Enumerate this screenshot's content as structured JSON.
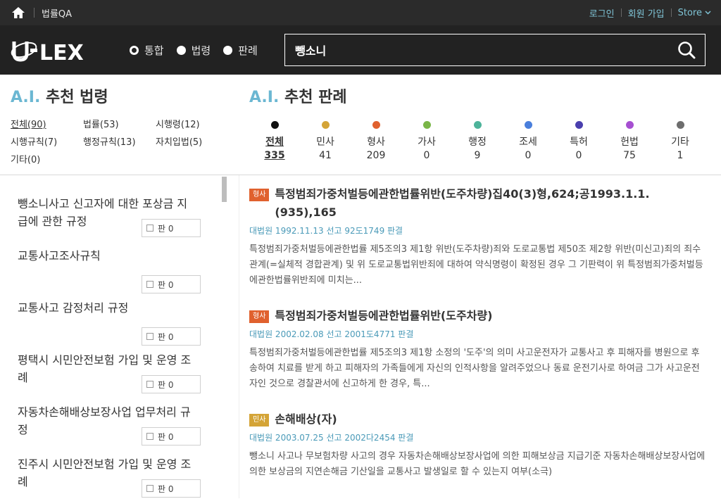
{
  "topbar": {
    "home_icon": "home-icon",
    "breadcrumb": "법률QA",
    "login": "로그인",
    "signup": "회원 가입",
    "store": "Store"
  },
  "header": {
    "logo": "U-LEX",
    "scopes": [
      {
        "label": "통합",
        "selected": true
      },
      {
        "label": "법령",
        "selected": false
      },
      {
        "label": "판례",
        "selected": false
      }
    ],
    "search": {
      "value": "뺑소니",
      "icon": "search-icon"
    }
  },
  "law_filter": {
    "heading_prefix": "A.I.",
    "heading": "추천 법령",
    "links": [
      {
        "label": "전체(90)",
        "active": true
      },
      {
        "label": "법률(53)",
        "active": false
      },
      {
        "label": "시행령(12)",
        "active": false
      },
      {
        "label": "시행규칙(7)",
        "active": false
      },
      {
        "label": "행정규칙(13)",
        "active": false
      },
      {
        "label": "자치입법(5)",
        "active": false
      },
      {
        "label": "기타(0)",
        "active": false
      }
    ]
  },
  "case_filter": {
    "heading_prefix": "A.I.",
    "heading": "추천 판례",
    "categories": [
      {
        "label": "전체",
        "count": "335",
        "color": "#111111",
        "active": true
      },
      {
        "label": "민사",
        "count": "41",
        "color": "#d4a437",
        "active": false
      },
      {
        "label": "형사",
        "count": "209",
        "color": "#e0612e",
        "active": false
      },
      {
        "label": "가사",
        "count": "0",
        "color": "#7ab648",
        "active": false
      },
      {
        "label": "행정",
        "count": "9",
        "color": "#4db39a",
        "active": false
      },
      {
        "label": "조세",
        "count": "0",
        "color": "#4a7fdc",
        "active": false
      },
      {
        "label": "특허",
        "count": "0",
        "color": "#4a3fae",
        "active": false
      },
      {
        "label": "헌법",
        "count": "75",
        "color": "#a64fd1",
        "active": false
      },
      {
        "label": "기타",
        "count": "1",
        "color": "#6d6d6d",
        "active": false
      }
    ]
  },
  "laws": [
    {
      "title": "뺑소니사고 신고자에 대한 포상금 지급에 관한 규정",
      "cite": "판 0"
    },
    {
      "title": "교통사고조사규칙",
      "cite": "판 0"
    },
    {
      "title": "교통사고 감정처리 규정",
      "cite": "판 0"
    },
    {
      "title": "평택시 시민안전보험 가입 및 운영 조례",
      "cite": "판 0"
    },
    {
      "title": "자동차손해배상보장사업 업무처리 규정",
      "cite": "판 0"
    },
    {
      "title": "진주시 시민안전보험 가입 및 운영 조례",
      "cite": "판 0"
    }
  ],
  "cases": [
    {
      "badge": "형사",
      "badge_color": "#e0612e",
      "title": "특정범죄가중처벌등에관한법률위반(도주차량)집40(3)형,624;공1993.1.1.(935),165",
      "meta": "대법원 1992.11.13 선고 92도1749 판결",
      "excerpt": "특정범죄가중처벌등에관한법률 제5조의3 제1항 위반(도주차량)죄와 도로교통법 제50조 제2항 위반(미신고)죄의 죄수관계(=실체적 경합관계) 및 위 도로교통법위반죄에 대하여 약식명령이 확정된 경우 그 기판력이 위 특정범죄가중처벌등에관한법률위반죄에 미치는..."
    },
    {
      "badge": "형사",
      "badge_color": "#e0612e",
      "title": "특정범죄가중처벌등에관한법률위반(도주차량)",
      "meta": "대법원 2002.02.08 선고 2001도4771 판결",
      "excerpt": "특정범죄가중처벌등에관한법률 제5조의3 제1항 소정의 '도주'의 의미 사고운전자가 교통사고 후 피해자를 병원으로 후송하여 치료를 받게 하고 피해자의 가족들에게 자신의 인적사항을 알려주었으나 동료 운전기사로 하여금 그가 사고운전자인 것으로 경찰관서에 신고하게 한 경우, 특..."
    },
    {
      "badge": "민사",
      "badge_color": "#d4a437",
      "title": "손해배상(자)",
      "meta": "대법원 2003.07.25 선고 2002다2454 판결",
      "excerpt": "뺑소니 사고나 무보험차량 사고의 경우 자동차손해배상보장사업에 의한 피해보상금 지급기준 자동차손해배상보장사업에 의한 보상금의 지연손해금 기산일을 교통사고 발생일로 할 수 있는지 여부(소극)"
    }
  ]
}
